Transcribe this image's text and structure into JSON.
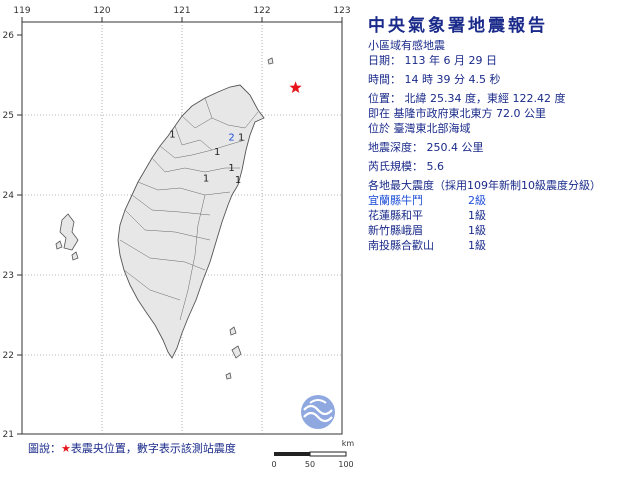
{
  "map": {
    "lon_ticks": [
      "119",
      "120",
      "121",
      "122",
      "123"
    ],
    "lat_ticks": [
      "26",
      "25",
      "24",
      "23",
      "22",
      "21"
    ],
    "epicenter": {
      "lon": 122.42,
      "lat": 25.34,
      "icon": "red-star-icon",
      "color": "#e8141b"
    },
    "station_marks": [
      {
        "value": "2",
        "lon": 121.62,
        "lat": 24.68,
        "color": "#1e4fd8"
      },
      {
        "value": "1",
        "lon": 121.74,
        "lat": 24.68,
        "color": "#222222"
      },
      {
        "value": "1",
        "lon": 120.88,
        "lat": 24.72,
        "color": "#222222"
      },
      {
        "value": "1",
        "lon": 121.44,
        "lat": 24.5,
        "color": "#222222"
      },
      {
        "value": "1",
        "lon": 121.3,
        "lat": 24.17,
        "color": "#222222"
      },
      {
        "value": "1",
        "lon": 121.62,
        "lat": 24.3,
        "color": "#222222"
      },
      {
        "value": "1",
        "lon": 121.7,
        "lat": 24.15,
        "color": "#222222"
      }
    ],
    "land_color": "#e7e7e7",
    "border_color": "#555555"
  },
  "report": {
    "title": "中央氣象署地震報告",
    "subtitle": "小區域有感地震",
    "date": "日期： 113 年 6 月 29 日",
    "time": "時間： 14 時 39 分 4.5 秒",
    "position": "位置： 北緯 25.34 度，東經 122.42 度",
    "relative": "即在 基隆市政府東北東方 72.0 公里",
    "region": "位於 臺灣東北部海域",
    "depth": "地震深度： 250.4 公里",
    "magnitude": "芮氏規模： 5.6",
    "intensity_header": "各地最大震度（採用109年新制10級震度分級）",
    "intensities": [
      {
        "station": "宜蘭縣牛鬥",
        "level": "2級"
      },
      {
        "station": "花蓮縣和平",
        "level": "1級"
      },
      {
        "station": "新竹縣峨眉",
        "level": "1級"
      },
      {
        "station": "南投縣合歡山",
        "level": "1級"
      }
    ]
  },
  "legend": {
    "prefix": "圖說：",
    "star": "★",
    "text": "表震央位置，數字表示該測站震度"
  },
  "scale": {
    "unit": "km",
    "ticks": [
      "0",
      "50",
      "100"
    ]
  }
}
